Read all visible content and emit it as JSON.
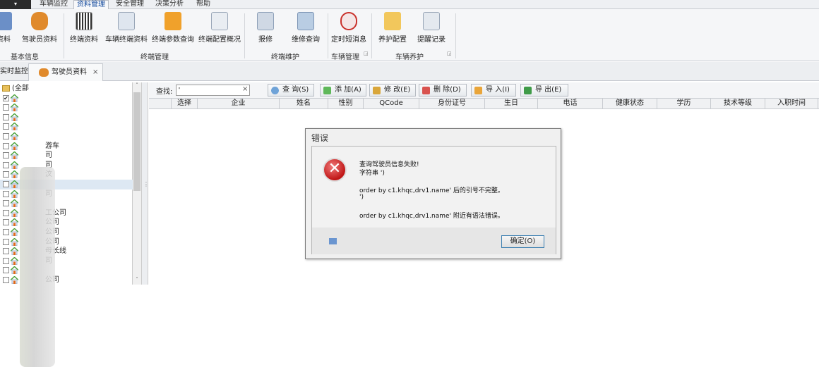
{
  "menu": {
    "app_button": "▾",
    "tabs": [
      "车辆监控",
      "资料管理",
      "安全管理",
      "决策分析",
      "帮助"
    ],
    "active_tab": "资料管理"
  },
  "ribbon": {
    "groups": [
      {
        "label": "基本信息",
        "buttons": [
          "资料",
          "驾驶员资料"
        ]
      },
      {
        "label": "终端管理",
        "buttons": [
          "终端资料",
          "车辆终端资料",
          "终端参数查询",
          "终端配置概况"
        ]
      },
      {
        "label": "终端维护",
        "buttons": [
          "报修",
          "维修查询"
        ]
      },
      {
        "label": "车辆管理",
        "buttons": [
          "定时短消息"
        ]
      },
      {
        "label": "车辆养护",
        "buttons": [
          "养护配置",
          "提醒记录"
        ]
      }
    ]
  },
  "doc_tabs": [
    {
      "label": "实时监控"
    },
    {
      "label": "驾驶员资料",
      "close": "×"
    }
  ],
  "tree": {
    "root": "(全部",
    "items": [
      "",
      "",
      "",
      "",
      "",
      "游车",
      "司",
      "司",
      "汶",
      "",
      "司",
      "",
      "工公司",
      "公司",
      "公司",
      "公司",
      "母长线",
      "司",
      "",
      "公司"
    ],
    "checked_index": 0,
    "selected_index": 9
  },
  "toolbar": {
    "search_label": "查找:",
    "search_value": "'",
    "clear": "×",
    "buttons": [
      "查 询(S)",
      "添 加(A)",
      "修 改(E)",
      "删 除(D)",
      "导 入(I)",
      "导 出(E)"
    ]
  },
  "grid": {
    "columns": [
      "",
      "选择",
      "企业",
      "姓名",
      "性别",
      "QCode",
      "身份证号",
      "生日",
      "电话",
      "健康状态",
      "学历",
      "技术等级",
      "入职时间"
    ]
  },
  "dialog": {
    "title": "错误",
    "lines": [
      "查询驾驶员信息失败!",
      "字符串 ')",
      "order by c1.khqc,drv1.name' 后的引号不完整。",
      "')",
      "order by c1.khqc,drv1.name' 附近有语法错误。"
    ],
    "ok": "确定(O)"
  }
}
